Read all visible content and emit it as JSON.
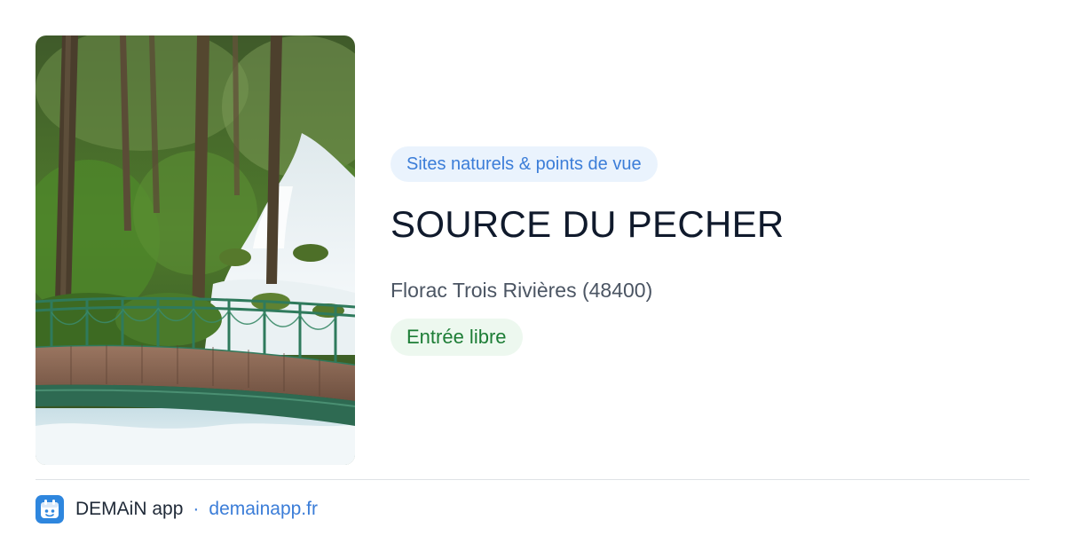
{
  "listing": {
    "category": "Sites naturels & points de vue",
    "title": "SOURCE DU PECHER",
    "location": "Florac Trois Rivières (48400)",
    "price": "Entrée libre"
  },
  "footer": {
    "app_name": "DEMAiN app",
    "separator": "·",
    "domain": "demainapp.fr"
  },
  "colors": {
    "accent_blue": "#3b7dd8",
    "category_bg": "#eaf3fd",
    "price_green": "#1d7d36",
    "price_bg": "#edf8ef",
    "title": "#101a2c",
    "logo_bg": "#2e86de"
  },
  "icons": {
    "app_logo": "demain-calendar-icon"
  }
}
